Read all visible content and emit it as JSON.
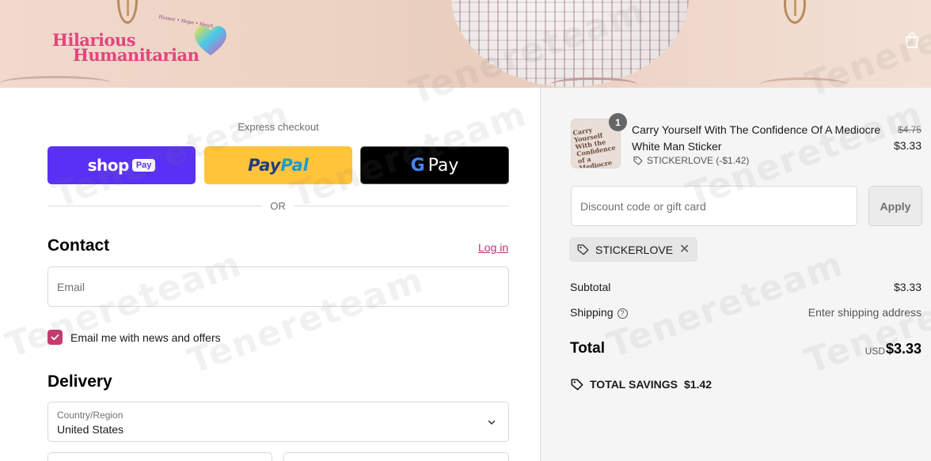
{
  "brand": {
    "logo_line1": "Hilarious",
    "logo_line2": "Humanitarian",
    "logo_tagline": "Humor • Hope • Heart"
  },
  "express": {
    "label": "Express checkout",
    "shop_word": "shop",
    "shop_pay": "Pay",
    "paypal_a": "Pay",
    "paypal_b": "Pal",
    "gpay_g": "G",
    "gpay_word": "Pay",
    "or_label": "OR"
  },
  "contact": {
    "title": "Contact",
    "login_label": "Log in",
    "email_placeholder": "Email",
    "newsletter_label": "Email me with news and offers",
    "newsletter_checked": true
  },
  "delivery": {
    "title": "Delivery",
    "country_label": "Country/Region",
    "country_value": "United States"
  },
  "order": {
    "item": {
      "quantity": "1",
      "name": "Carry Yourself With The Confidence Of A Mediocre White Man Sticker",
      "discount_note": "STICKERLOVE (-$1.42)",
      "price_original": "$4.75",
      "price_current": "$3.33",
      "thumb_text": "Carry Yourself With the Confidence of a Mediocre White Man"
    },
    "discount_placeholder": "Discount code or gift card",
    "apply_label": "Apply",
    "applied_code": "STICKERLOVE",
    "subtotal_label": "Subtotal",
    "subtotal_value": "$3.33",
    "shipping_label": "Shipping",
    "shipping_value": "Enter shipping address",
    "total_label": "Total",
    "total_currency": "USD",
    "total_value": "$3.33",
    "savings_label": "TOTAL SAVINGS",
    "savings_value": "$1.42"
  },
  "watermark": "Tenereteam",
  "colors": {
    "shop_purple": "#5a31f4",
    "paypal_yellow": "#ffc439",
    "gpay_black": "#000000",
    "accent_pink": "#c8396f"
  }
}
